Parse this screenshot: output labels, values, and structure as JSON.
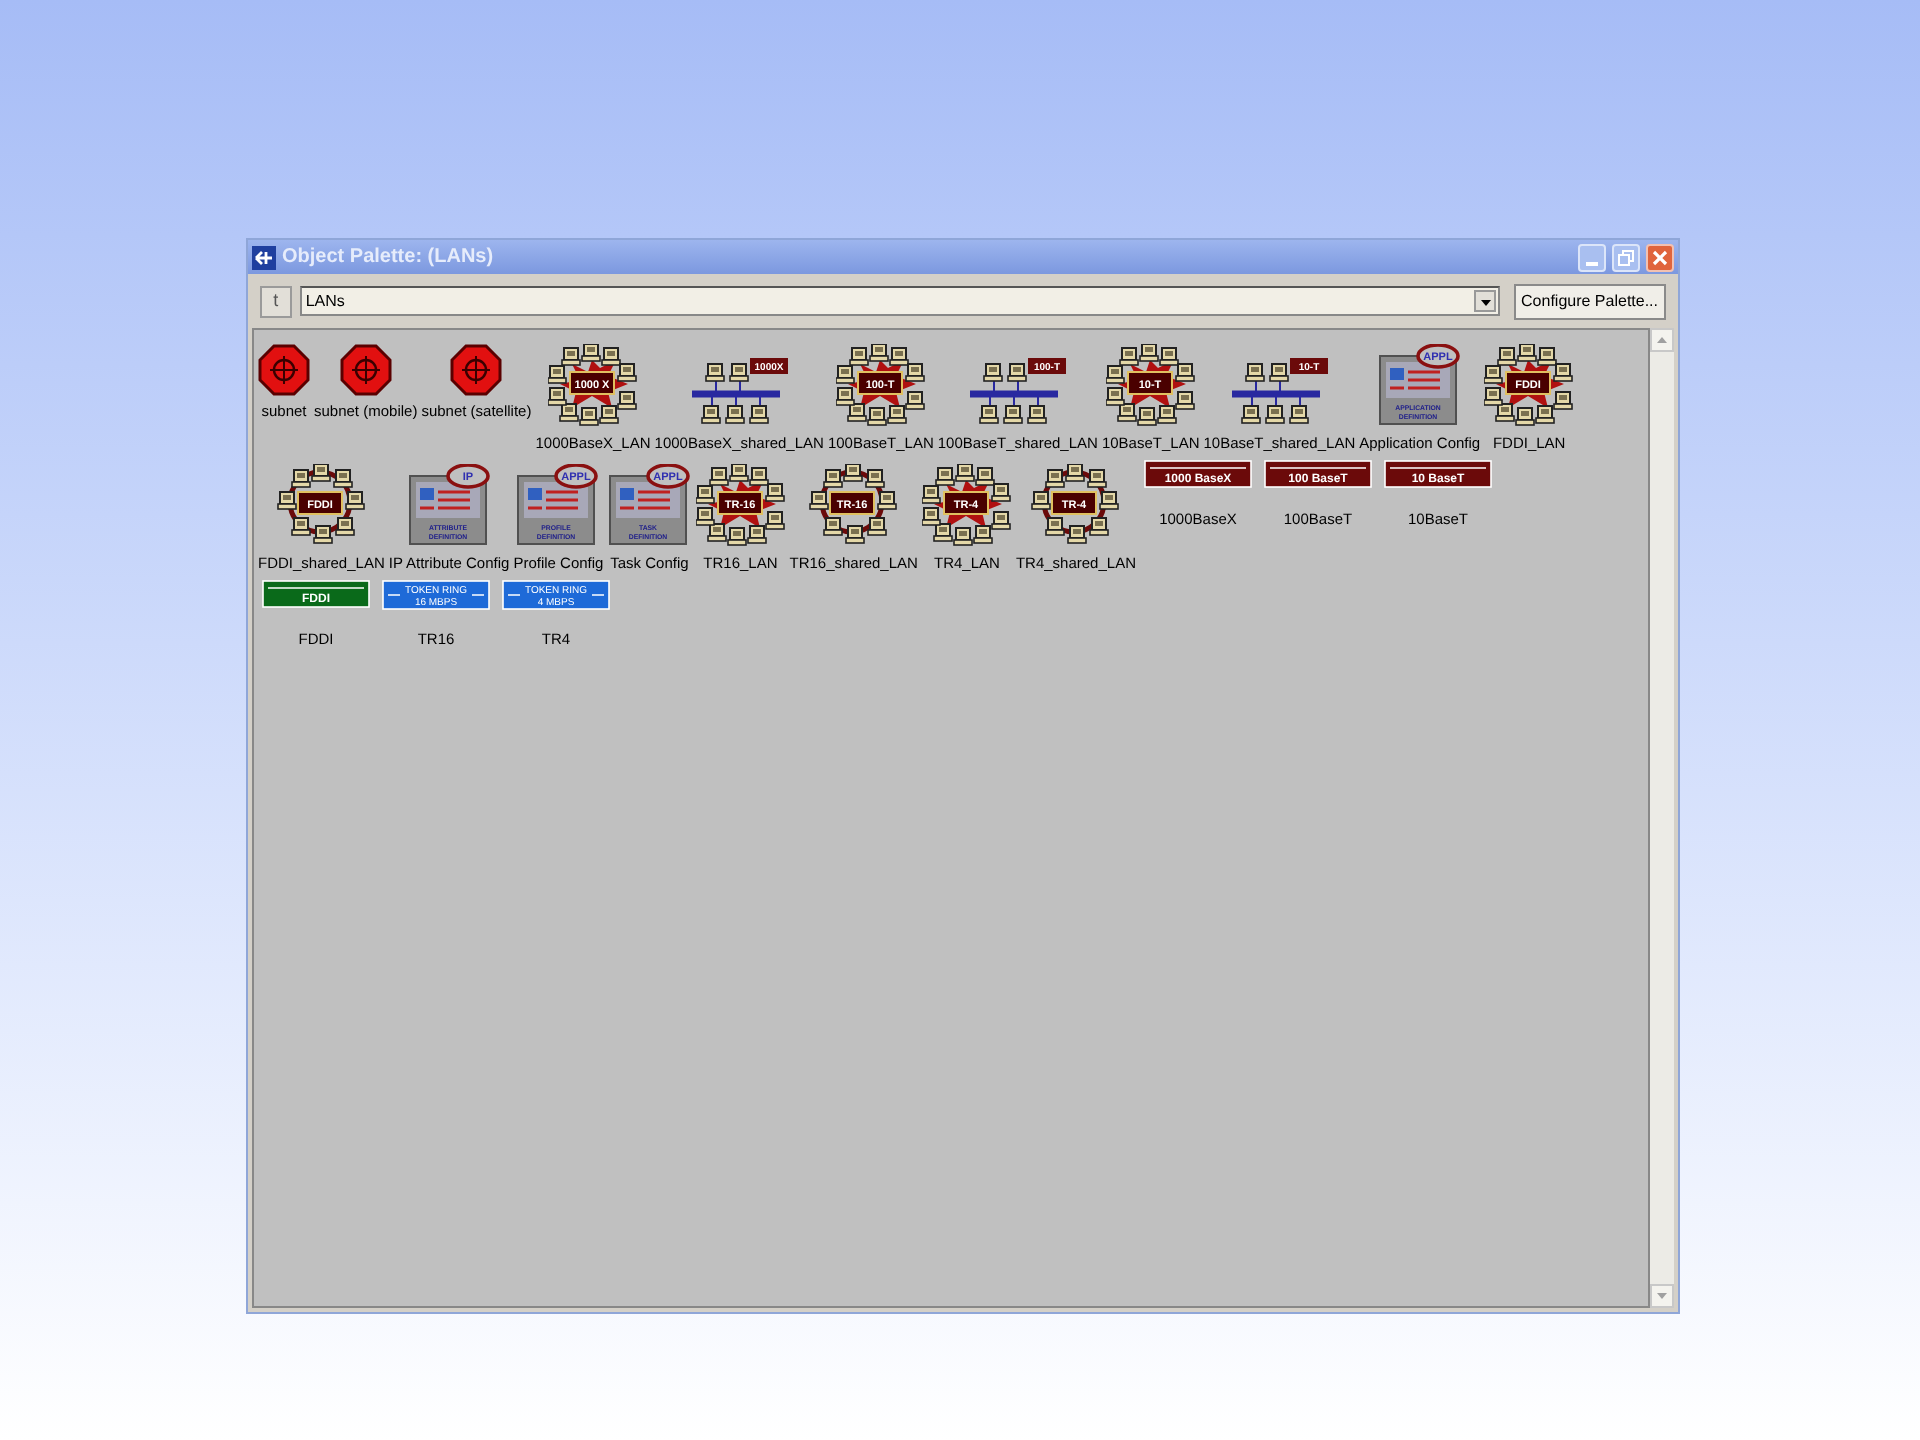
{
  "window": {
    "title": "Object Palette: (LANs)"
  },
  "toolbar": {
    "up_button": "t",
    "palette": "LANs",
    "configure_button": "Configure Palette..."
  },
  "rows": [
    [
      {
        "kind": "subnet",
        "label": "subnet"
      },
      {
        "kind": "subnet",
        "label": "subnet (mobile)"
      },
      {
        "kind": "subnet",
        "label": "subnet (satellite)"
      },
      {
        "kind": "star",
        "label": "1000BaseX_LAN",
        "badge": "1000 X"
      },
      {
        "kind": "bus",
        "label": "1000BaseX_shared_LAN",
        "badge": "1000X"
      },
      {
        "kind": "star",
        "label": "100BaseT_LAN",
        "badge": "100-T"
      },
      {
        "kind": "bus",
        "label": "100BaseT_shared_LAN",
        "badge": "100-T"
      },
      {
        "kind": "star",
        "label": "10BaseT_LAN",
        "badge": "10-T"
      },
      {
        "kind": "bus",
        "label": "10BaseT_shared_LAN",
        "badge": "10-T"
      },
      {
        "kind": "config",
        "label": "Application Config",
        "badge": "APPL",
        "caption": "APPLICATION DEFINITION"
      },
      {
        "kind": "star",
        "label": "FDDI_LAN",
        "badge": "FDDI"
      }
    ],
    [
      {
        "kind": "ring",
        "label": "FDDI_shared_LAN",
        "badge": "FDDI"
      },
      {
        "kind": "config",
        "label": "IP Attribute Config",
        "badge": "IP",
        "caption": "ATTRIBUTE DEFINITION"
      },
      {
        "kind": "config",
        "label": "Profile Config",
        "badge": "APPL",
        "caption": "PROFILE DEFINITION"
      },
      {
        "kind": "config",
        "label": "Task Config",
        "badge": "APPL",
        "caption": "TASK DEFINITION"
      },
      {
        "kind": "star",
        "label": "TR16_LAN",
        "badge": "TR-16"
      },
      {
        "kind": "ring",
        "label": "TR16_shared_LAN",
        "badge": "TR-16"
      },
      {
        "kind": "star",
        "label": "TR4_LAN",
        "badge": "TR-4"
      },
      {
        "kind": "ring",
        "label": "TR4_shared_LAN",
        "badge": "TR-4"
      },
      {
        "kind": "link",
        "label": "1000BaseX",
        "badge": "1000 BaseX",
        "color": "#6b0a0a"
      },
      {
        "kind": "link",
        "label": "100BaseT",
        "badge": "100 BaseT",
        "color": "#6b0a0a"
      },
      {
        "kind": "link",
        "label": "10BaseT",
        "badge": "10 BaseT",
        "color": "#6b0a0a"
      }
    ],
    [
      {
        "kind": "link",
        "label": "FDDI",
        "badge": "FDDI",
        "color": "#0a6a1a"
      },
      {
        "kind": "link",
        "label": "TR16",
        "badge": "TOKEN RING",
        "badge2": "16 MBPS",
        "color": "#1e6ad8"
      },
      {
        "kind": "link",
        "label": "TR4",
        "badge": "TOKEN RING",
        "badge2": "4 MBPS",
        "color": "#1e6ad8"
      }
    ]
  ]
}
